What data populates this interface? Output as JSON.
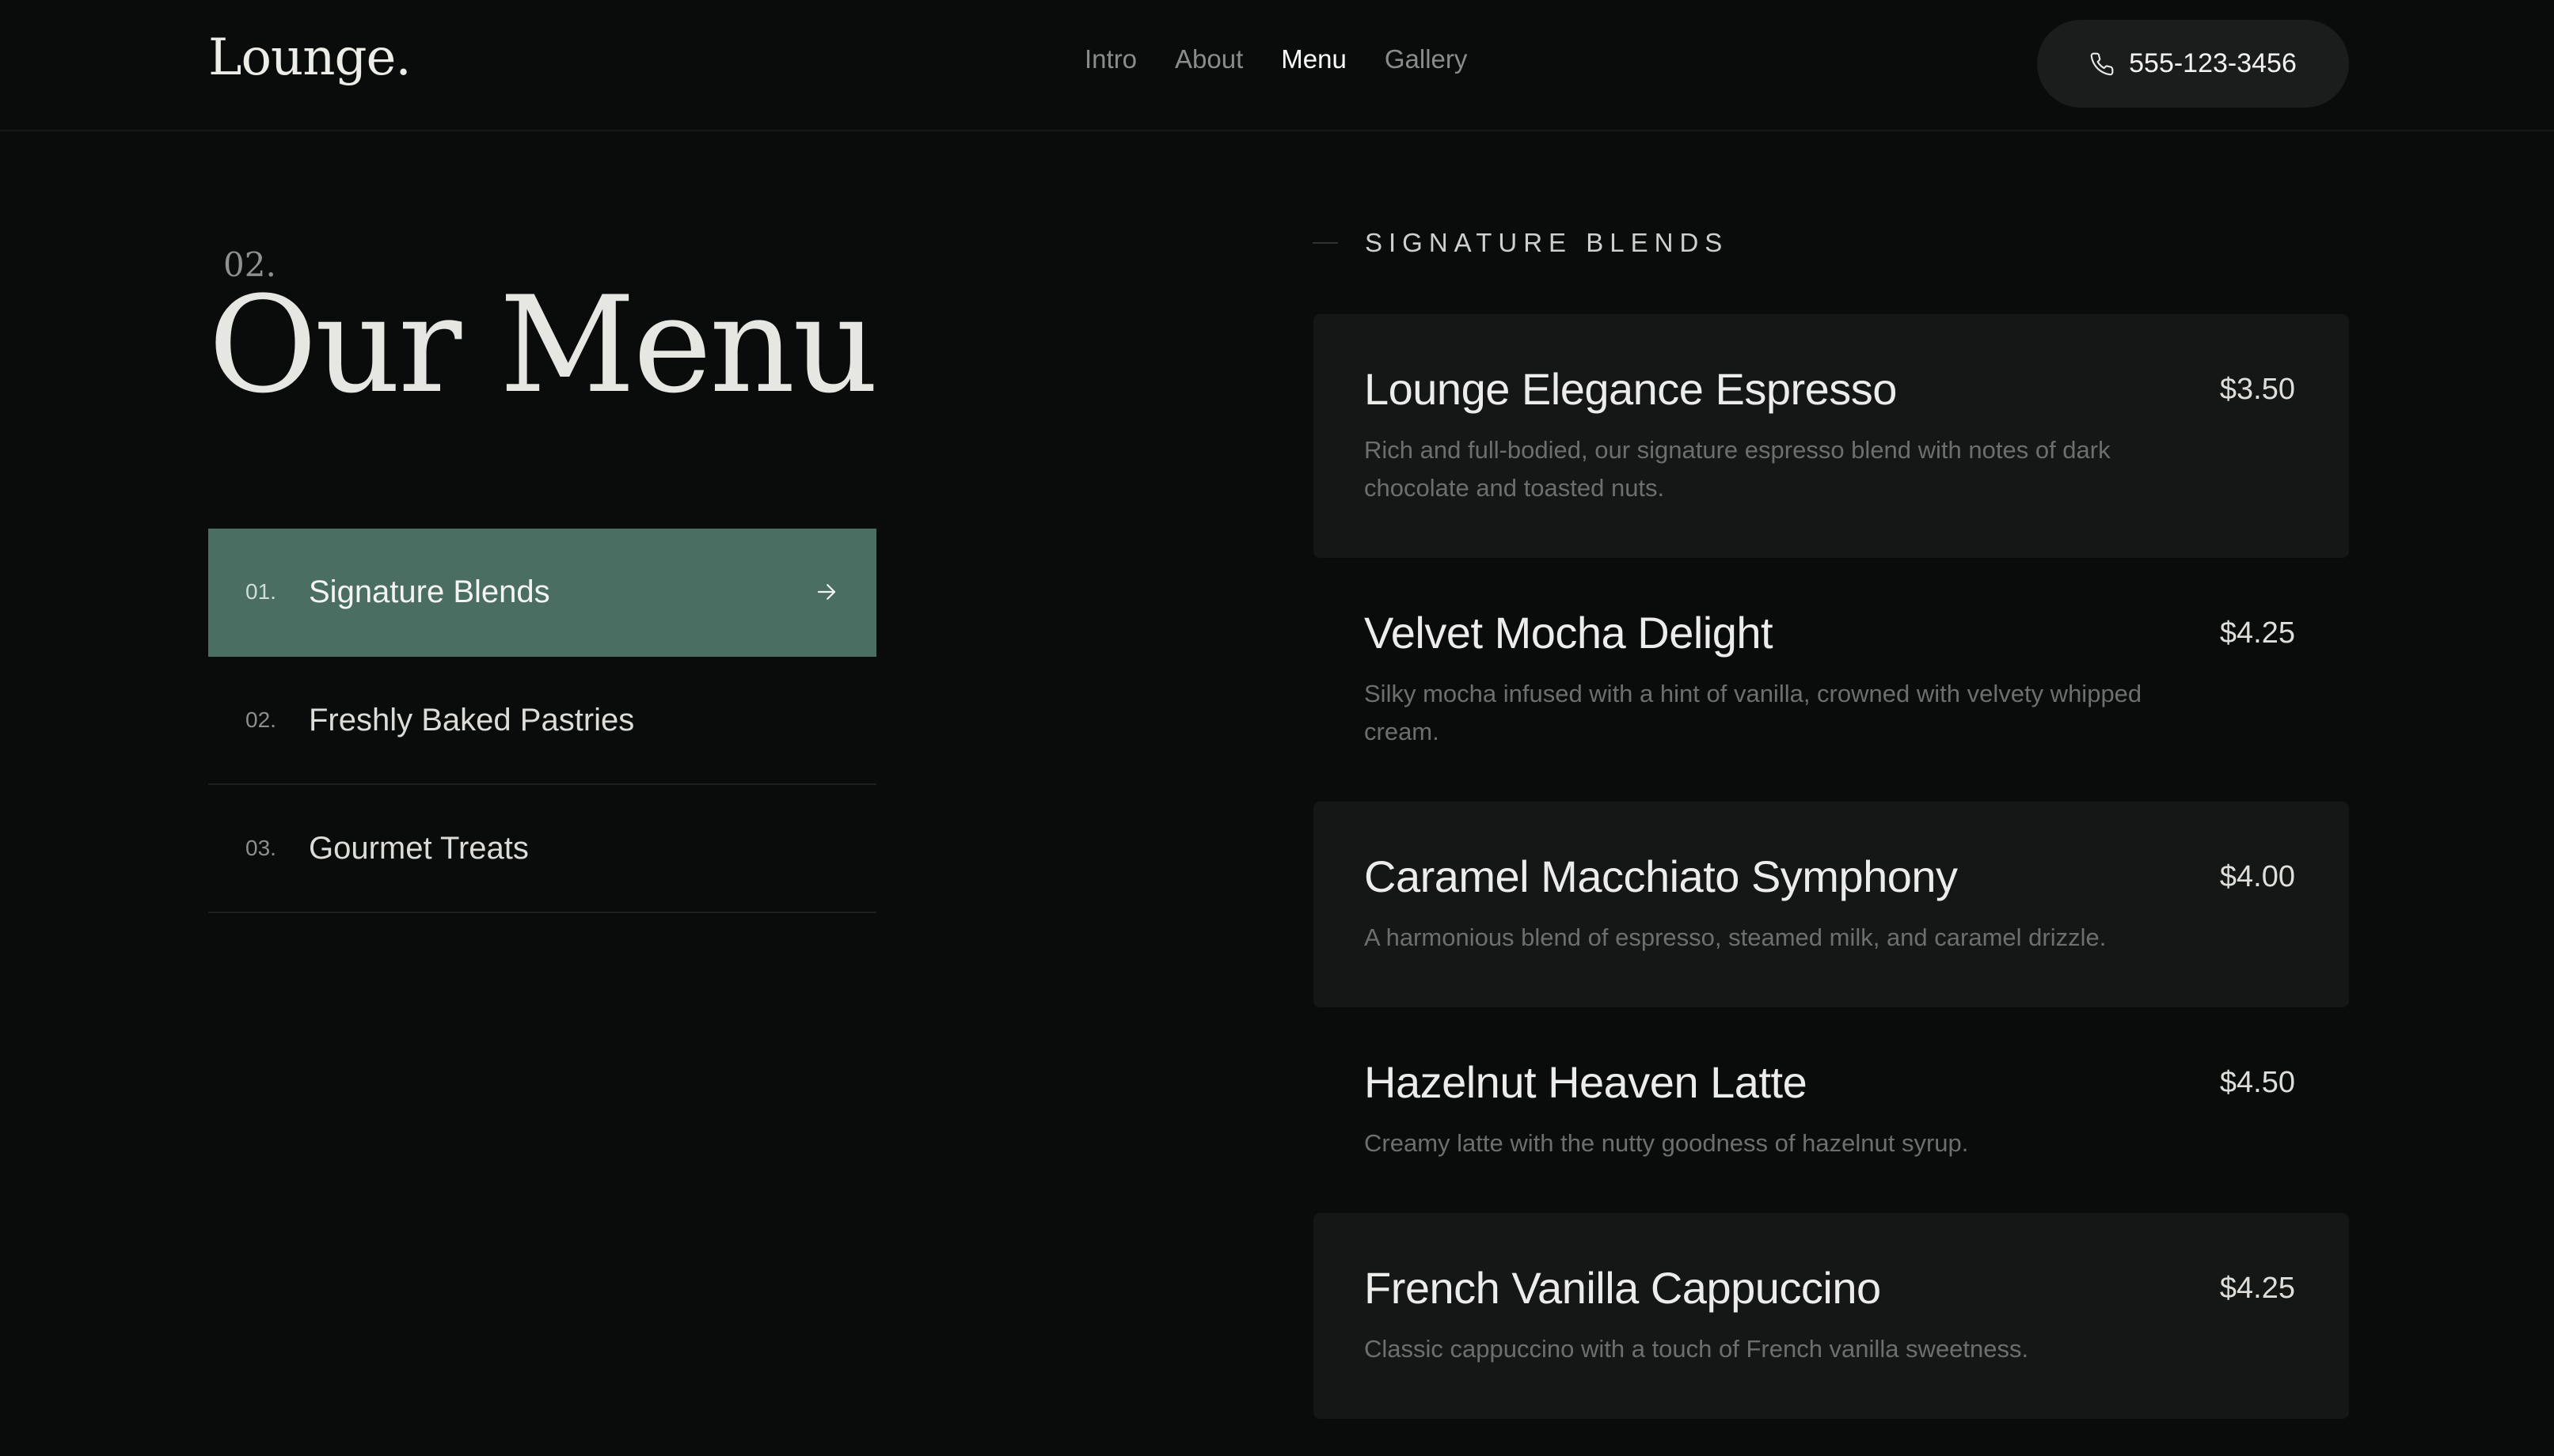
{
  "header": {
    "logo": "Lounge.",
    "nav": [
      "Intro",
      "About",
      "Menu",
      "Gallery"
    ],
    "active_nav": "Menu",
    "phone": "555-123-3456"
  },
  "section": {
    "number": "02.",
    "title": "Our Menu"
  },
  "categories": [
    {
      "num": "01.",
      "label": "Signature Blends",
      "active": true
    },
    {
      "num": "02.",
      "label": "Freshly Baked Pastries",
      "active": false
    },
    {
      "num": "03.",
      "label": "Gourmet Treats",
      "active": false
    }
  ],
  "menu": {
    "heading": "SIGNATURE BLENDS",
    "items": [
      {
        "name": "Lounge Elegance Espresso",
        "price": "$3.50",
        "desc": "Rich and full-bodied, our signature espresso blend with notes of dark chocolate and toasted nuts."
      },
      {
        "name": "Velvet Mocha Delight",
        "price": "$4.25",
        "desc": "Silky mocha infused with a hint of vanilla, crowned with velvety whipped cream."
      },
      {
        "name": "Caramel Macchiato Symphony",
        "price": "$4.00",
        "desc": "A harmonious blend of espresso, steamed milk, and caramel drizzle."
      },
      {
        "name": "Hazelnut Heaven Latte",
        "price": "$4.50",
        "desc": "Creamy latte with the nutty goodness of hazelnut syrup."
      },
      {
        "name": "French Vanilla Cappuccino",
        "price": "$4.25",
        "desc": "Classic cappuccino with a touch of French vanilla sweetness."
      }
    ]
  },
  "colors": {
    "background": "#0a0c0c",
    "accent": "#4a6f62",
    "card": "#151717"
  },
  "icons": {
    "phone": "phone-icon",
    "arrow": "arrow-right-icon"
  }
}
